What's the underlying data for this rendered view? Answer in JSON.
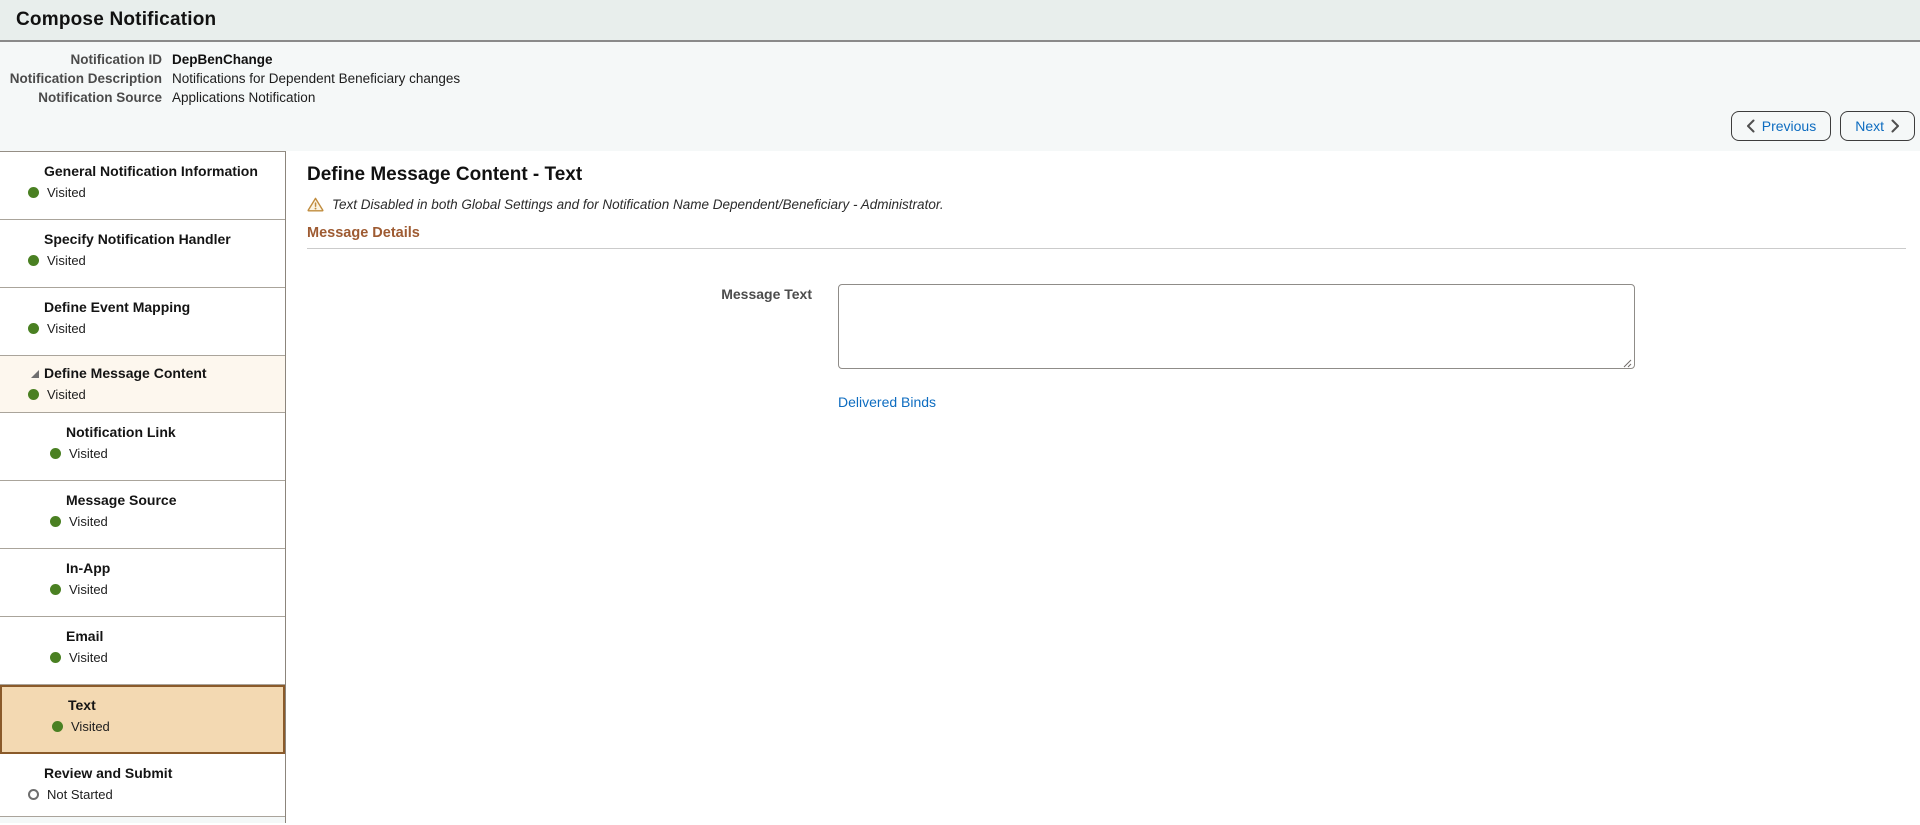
{
  "page": {
    "title": "Compose Notification"
  },
  "header": {
    "fields": [
      {
        "label": "Notification ID",
        "value": "DepBenChange"
      },
      {
        "label": "Notification Description",
        "value": "Notifications for Dependent Beneficiary changes"
      },
      {
        "label": "Notification Source",
        "value": "Applications Notification"
      }
    ],
    "buttons": {
      "previous": "Previous",
      "next": "Next"
    }
  },
  "sidebar": {
    "items": [
      {
        "label": "General Notification Information",
        "status": "Visited",
        "level": 0,
        "state": "visited",
        "active": false
      },
      {
        "label": "Specify Notification Handler",
        "status": "Visited",
        "level": 0,
        "state": "visited",
        "active": false
      },
      {
        "label": "Define Event Mapping",
        "status": "Visited",
        "level": 0,
        "state": "visited",
        "active": false
      },
      {
        "label": "Define Message Content",
        "status": "Visited",
        "level": 0,
        "state": "visited",
        "active": false,
        "expanded": true
      },
      {
        "label": "Notification Link",
        "status": "Visited",
        "level": 1,
        "state": "visited",
        "active": false
      },
      {
        "label": "Message Source",
        "status": "Visited",
        "level": 1,
        "state": "visited",
        "active": false
      },
      {
        "label": "In-App",
        "status": "Visited",
        "level": 1,
        "state": "visited",
        "active": false
      },
      {
        "label": "Email",
        "status": "Visited",
        "level": 1,
        "state": "visited",
        "active": false
      },
      {
        "label": "Text",
        "status": "Visited",
        "level": 1,
        "state": "visited",
        "active": true
      },
      {
        "label": "Review and Submit",
        "status": "Not Started",
        "level": 0,
        "state": "not-started",
        "active": false
      }
    ]
  },
  "main": {
    "heading": "Define Message Content - Text",
    "warning": "Text Disabled in both Global Settings and for Notification Name Dependent/Beneficiary - Administrator.",
    "section_title": "Message Details",
    "message_text_label": "Message Text",
    "message_text_value": "",
    "delivered_binds_link": "Delivered Binds"
  },
  "icons": {
    "previous": "chevron-left",
    "next": "chevron-right",
    "expanded_marker": "triangle-expanded",
    "warning": "warning-triangle",
    "visited": "filled-circle-green",
    "not_started": "hollow-circle"
  },
  "colors": {
    "accent_blue": "#0d6cc0",
    "active_step_bg": "#f3d9b2",
    "active_step_border": "#8a5a2a",
    "parent_step_bg": "#fdf7ee",
    "visited_green": "#4a8022",
    "section_title_brown": "#9e5b32",
    "warning_orange": "#c08c3e",
    "topbar_bg": "#e8eeec",
    "infoband_bg": "#f5f8f8"
  }
}
